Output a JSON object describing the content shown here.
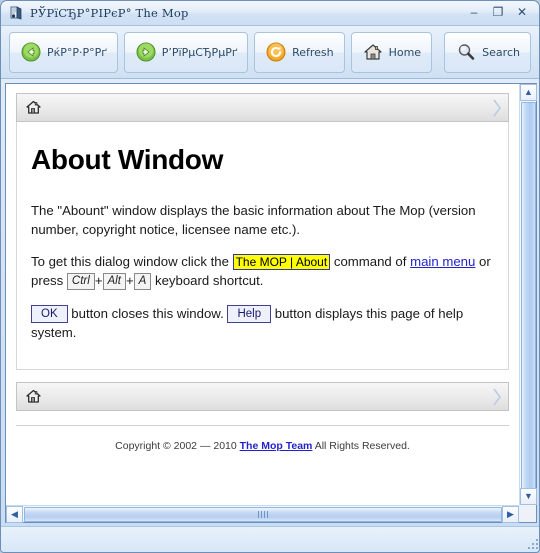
{
  "window": {
    "title": "РЎРїСЂР°РІРєР° The Mop",
    "icon": "help-book-icon",
    "controls": {
      "minimize": "–",
      "maximize": "❐",
      "close": "✕"
    }
  },
  "toolbar": {
    "buttons": [
      {
        "label": "РќР°Р·Р°Рґ",
        "icon": "back-arrow-icon",
        "name": "back-button"
      },
      {
        "label": "Р’РїРµСЂРµРґ",
        "icon": "forward-arrow-icon",
        "name": "forward-button"
      },
      {
        "label": "Refresh",
        "icon": "refresh-icon",
        "name": "refresh-button"
      },
      {
        "label": "Home",
        "icon": "home-icon",
        "name": "home-button"
      }
    ],
    "search": {
      "label": "Search",
      "icon": "magnifier-icon",
      "name": "search-button"
    }
  },
  "breadcrumb": {
    "home_icon": "home-icon",
    "chevron_icon": "chevron-right-icon"
  },
  "page": {
    "title": "About Window",
    "paragraph1": "The \"Abount\" window displays the basic information about The Mop (version number, copyright notice, licensee name etc.).",
    "paragraph2": {
      "before_cmd": "To get this dialog window click the ",
      "command": "The MOP | About",
      "after_cmd": " command of ",
      "link": "main menu",
      "after_link": " or press ",
      "key1": "Ctrl",
      "plus1": "+",
      "key2": "Alt",
      "plus2": "+",
      "key3": "A",
      "tail": " keyboard shortcut."
    },
    "paragraph3": {
      "ok_button": "OK",
      "mid": " button closes this window. ",
      "help_button": "Help",
      "tail": " button displays this page of help system."
    }
  },
  "footer": {
    "before": "Copyright © 2002 — 2010 ",
    "link": "The Mop Team",
    "after": " All Rights Reserved."
  },
  "scrollbars": {
    "up_arrow": "▲",
    "down_arrow": "▼",
    "left_arrow": "◀",
    "right_arrow": "▶"
  },
  "colors": {
    "accent": "#2f5f9e",
    "frame_border": "#6b8fb8",
    "highlight_yellow": "#ffff00",
    "link_blue": "#2222cc"
  }
}
